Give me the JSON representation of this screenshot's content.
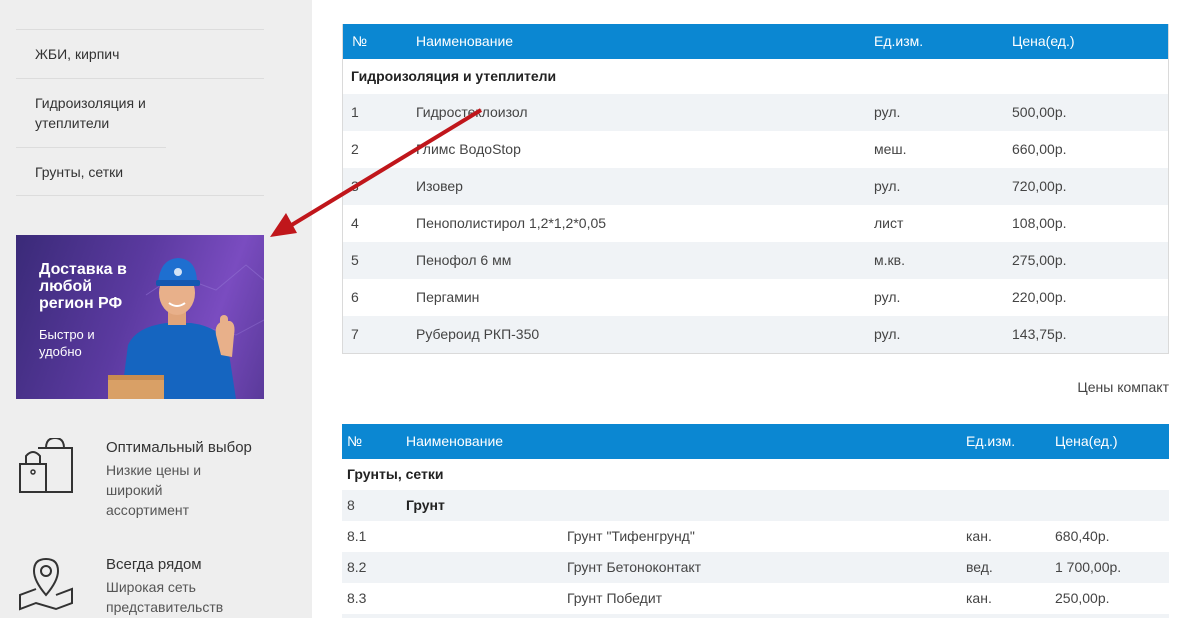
{
  "sidebar": {
    "menu": [
      {
        "label": "ЖБИ, кирпич"
      },
      {
        "label": "Гидроизоляция и утеплители"
      },
      {
        "label": "Грунты, сетки"
      }
    ],
    "banner": {
      "title": "Доставка в любой регион РФ",
      "subtitle": "Быстро и удобно"
    },
    "features": [
      {
        "title": "Оптимальный выбор",
        "desc": "Низкие цены и широкий ассортимент",
        "icon": "shopping-bags-icon"
      },
      {
        "title": "Всегда рядом",
        "desc": "Широкая сеть представительств",
        "icon": "map-pin-icon"
      }
    ]
  },
  "table1": {
    "headers": [
      "№",
      "Наименование",
      "Ед.изм.",
      "Цена(ед.)"
    ],
    "category": "Гидроизоляция и утеплители",
    "rows": [
      {
        "num": "1",
        "name": "Гидростеклоизол",
        "unit": "рул.",
        "price": "500,00р."
      },
      {
        "num": "2",
        "name": "Глимс ВодоStop",
        "unit": "меш.",
        "price": "660,00р."
      },
      {
        "num": "3",
        "name": "Изовер",
        "unit": "рул.",
        "price": "720,00р."
      },
      {
        "num": "4",
        "name": "Пенополистирол 1,2*1,2*0,05",
        "unit": "лист",
        "price": "108,00р."
      },
      {
        "num": "5",
        "name": "Пенофол 6 мм",
        "unit": "м.кв.",
        "price": "275,00р."
      },
      {
        "num": "6",
        "name": "Пергамин",
        "unit": "рул.",
        "price": "220,00р."
      },
      {
        "num": "7",
        "name": "Рубероид РКП-350",
        "unit": "рул.",
        "price": "143,75р."
      }
    ]
  },
  "compact_link": "Цены компакт",
  "table2": {
    "headers": [
      "№",
      "Наименование",
      "Ед.изм.",
      "Цена(ед.)"
    ],
    "category": "Грунты, сетки",
    "group": {
      "num": "8",
      "name": "Грунт"
    },
    "rows": [
      {
        "num": "8.1",
        "name": "Грунт \"Тифенгрунд\"",
        "unit": "кан.",
        "price": "680,40р."
      },
      {
        "num": "8.2",
        "name": "Грунт Бетоноконтакт",
        "unit": "вед.",
        "price": "1 700,00р."
      },
      {
        "num": "8.3",
        "name": "Грунт Победит",
        "unit": "кан.",
        "price": "250,00р."
      }
    ]
  },
  "colors": {
    "header": "#0b87d2",
    "arrow": "#c0161b",
    "sidebar": "#eeeeee"
  }
}
